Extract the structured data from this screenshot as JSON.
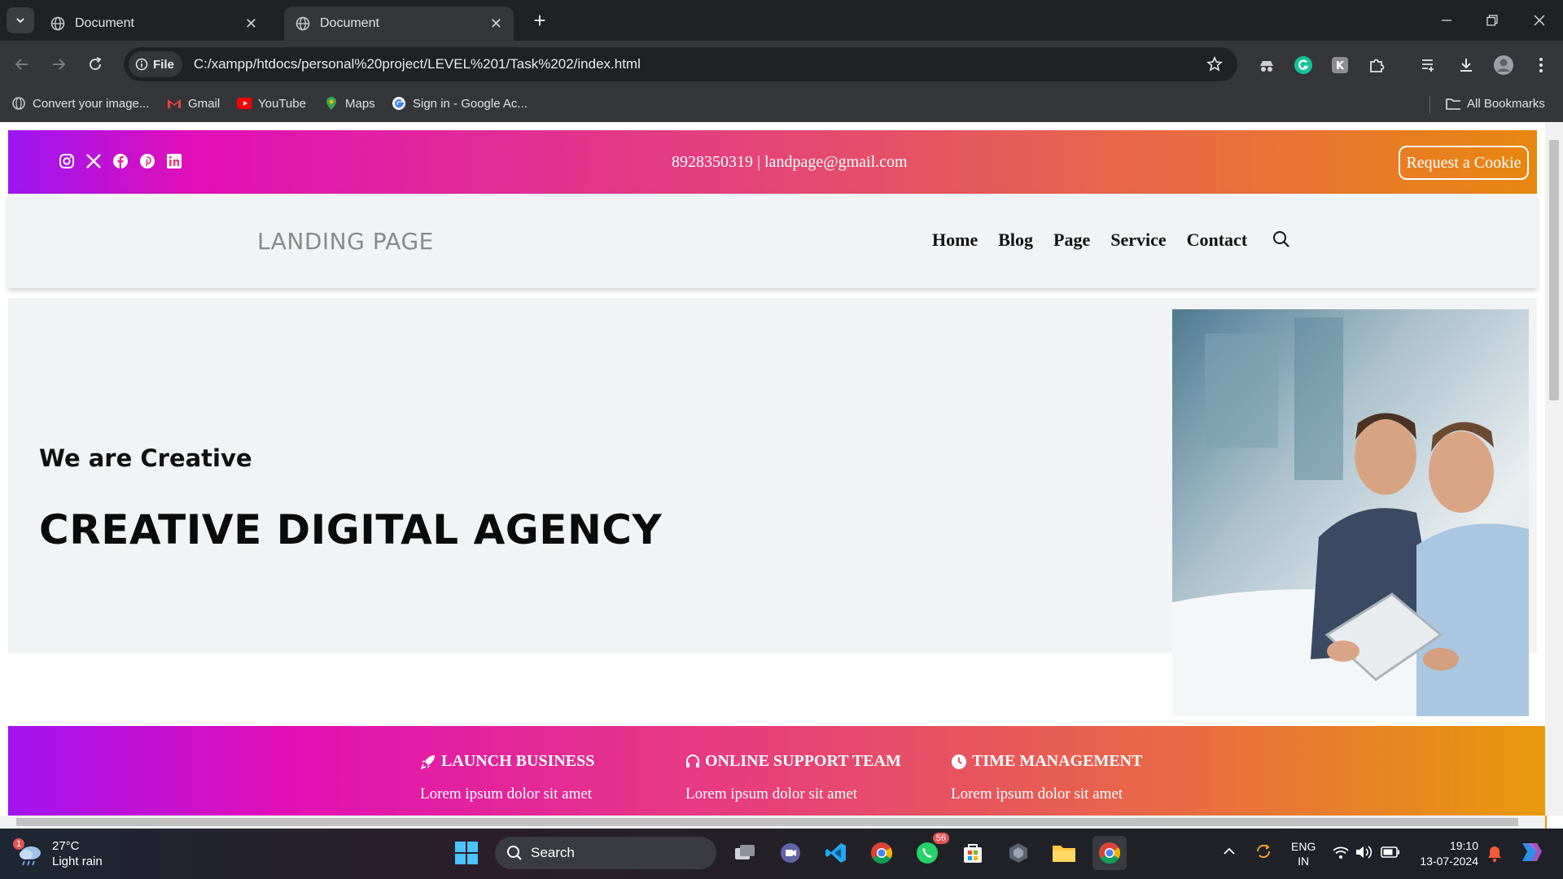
{
  "browser": {
    "tabs": [
      {
        "title": "Document",
        "active": false
      },
      {
        "title": "Document",
        "active": true
      }
    ],
    "file_chip": "File",
    "url": "C:/xampp/htdocs/personal%20project/LEVEL%201/Task%202/index.html",
    "bookmarks": [
      "Convert your image...",
      "Gmail",
      "YouTube",
      "Maps",
      "Sign in - Google Ac..."
    ],
    "all_bookmarks": "All Bookmarks"
  },
  "site": {
    "contact": "8928350319 | landpage@gmail.com",
    "cookie_button": "Request a Cookie",
    "logo": "LANDING PAGE",
    "menu": [
      "Home",
      "Blog",
      "Page",
      "Service",
      "Contact"
    ],
    "hero": {
      "subtitle": "We are Creative",
      "title": "CREATIVE DIGITAL AGENCY"
    },
    "features": [
      {
        "title": "LAUNCH BUSINESS",
        "icon": "rocket-icon",
        "text": "Lorem ipsum dolor sit amet"
      },
      {
        "title": "ONLINE SUPPORT TEAM",
        "icon": "headset-icon",
        "text": "Lorem ipsum dolor sit amet"
      },
      {
        "title": "TIME MANAGEMENT",
        "icon": "clock-icon",
        "text": "Lorem ipsum dolor sit amet"
      }
    ],
    "colors": {
      "gradient_start": "#9b16f3",
      "gradient_mid": "#e10fb8",
      "gradient_end": "#e8870f"
    }
  },
  "taskbar": {
    "weather": {
      "temp": "27°C",
      "desc": "Light rain",
      "badge": "1"
    },
    "search": "Search",
    "whatsapp_badge": "56",
    "lang": {
      "line1": "ENG",
      "line2": "IN"
    },
    "time": "19:10",
    "date": "13-07-2024"
  }
}
